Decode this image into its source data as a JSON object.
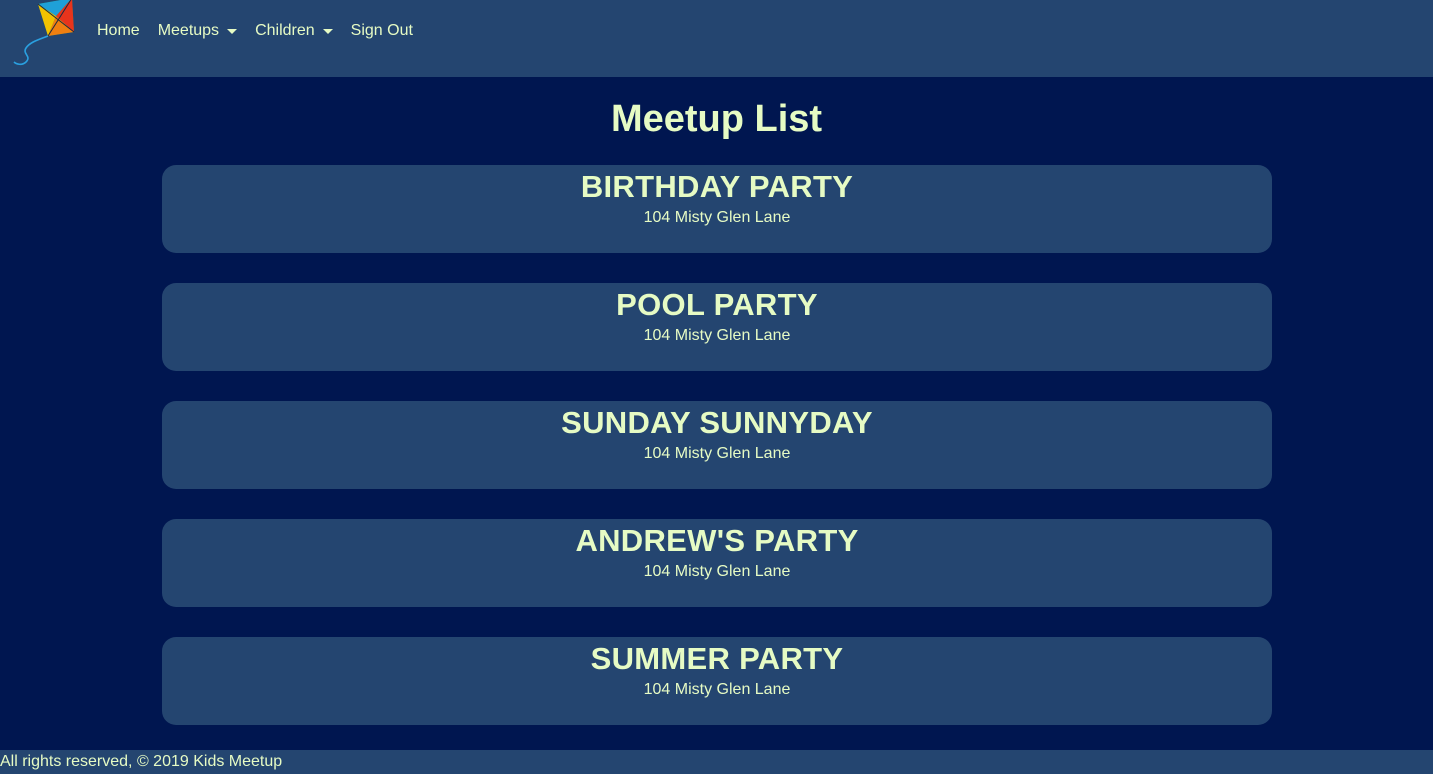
{
  "nav": {
    "logo_icon": "kite-icon",
    "items": [
      {
        "label": "Home",
        "dropdown": false
      },
      {
        "label": "Meetups",
        "dropdown": true
      },
      {
        "label": "Children",
        "dropdown": true
      },
      {
        "label": "Sign Out",
        "dropdown": false
      }
    ]
  },
  "page": {
    "title": "Meetup List"
  },
  "meetups": [
    {
      "title": "BIRTHDAY PARTY",
      "address": "104 Misty Glen Lane"
    },
    {
      "title": "POOL PARTY",
      "address": "104 Misty Glen Lane"
    },
    {
      "title": "SUNDAY SUNNYDAY",
      "address": "104 Misty Glen Lane"
    },
    {
      "title": "ANDREW'S PARTY",
      "address": "104 Misty Glen Lane"
    },
    {
      "title": "SUMMER PARTY",
      "address": "104 Misty Glen Lane"
    }
  ],
  "footer": {
    "text": "All rights reserved, © 2019 Kids Meetup"
  },
  "colors": {
    "background": "#001650",
    "panel": "#244570",
    "text": "#e6fbc4"
  }
}
